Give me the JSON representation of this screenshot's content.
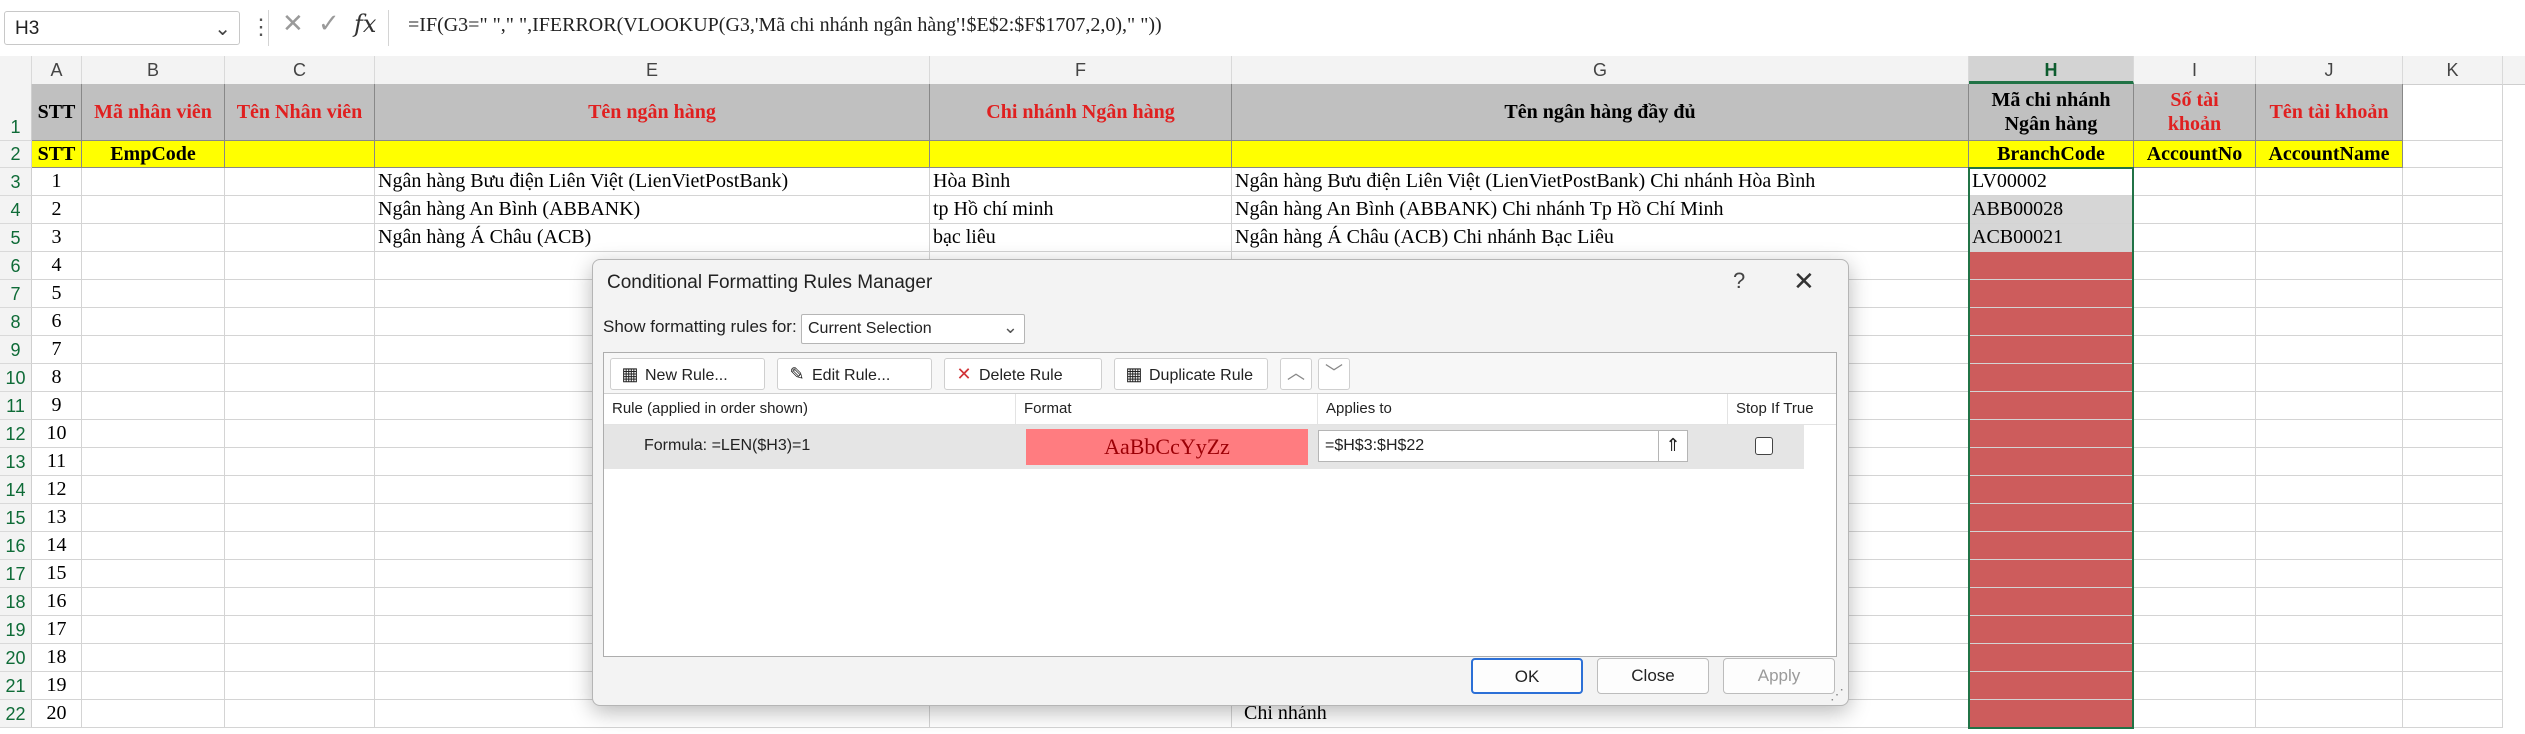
{
  "formula_bar": {
    "name_box": "H3",
    "formula": "=IF(G3=\" \",\" \",IFERROR(VLOOKUP(G3,'Mã chi nhánh ngân hàng'!$E$2:$F$1707,2,0),\" \"))"
  },
  "columns": [
    "A",
    "B",
    "C",
    "E",
    "F",
    "G",
    "H",
    "I",
    "J",
    "K"
  ],
  "header_row1": {
    "A": "STT",
    "B": "Mã nhân viên",
    "C": "Tên Nhân viên",
    "E": "Tên ngân hàng",
    "F": "Chi nhánh Ngân hàng",
    "G": "Tên ngân hàng đầy đủ",
    "H": "Mã chi nhánh Ngân hàng",
    "I": "Số tài khoản",
    "J": "Tên tài khoản"
  },
  "header_row2": {
    "A": "STT",
    "B": "EmpCode",
    "H": "BranchCode",
    "I": "AccountNo",
    "J": "AccountName"
  },
  "rows": [
    {
      "rn": "3",
      "stt": "1",
      "bank": "Ngân hàng Bưu điện Liên Việt (LienVietPostBank)",
      "branch": "Hòa Bình",
      "full": "Ngân hàng Bưu điện Liên Việt (LienVietPostBank) Chi nhánh Hòa Bình",
      "code": "LV00002"
    },
    {
      "rn": "4",
      "stt": "2",
      "bank": "Ngân hàng An Bình (ABBANK)",
      "branch": "tp Hồ chí minh",
      "full": "Ngân hàng An Bình (ABBANK) Chi nhánh Tp Hồ Chí Minh",
      "code": "ABB00028"
    },
    {
      "rn": "5",
      "stt": "3",
      "bank": "Ngân hàng Á Châu (ACB)",
      "branch": "bạc liêu",
      "full": "Ngân hàng Á Châu (ACB) Chi nhánh Bạc Liêu",
      "code": "ACB00021"
    },
    {
      "rn": "6",
      "stt": "4",
      "bank": "",
      "branch": "",
      "full": "",
      "code": ""
    },
    {
      "rn": "7",
      "stt": "5",
      "bank": "",
      "branch": "",
      "full": "",
      "code": ""
    },
    {
      "rn": "8",
      "stt": "6",
      "bank": "",
      "branch": "",
      "full": "",
      "code": ""
    },
    {
      "rn": "9",
      "stt": "7",
      "bank": "",
      "branch": "",
      "full": "",
      "code": ""
    },
    {
      "rn": "10",
      "stt": "8",
      "bank": "",
      "branch": "",
      "full": "",
      "code": ""
    },
    {
      "rn": "11",
      "stt": "9",
      "bank": "",
      "branch": "",
      "full": "",
      "code": ""
    },
    {
      "rn": "12",
      "stt": "10",
      "bank": "",
      "branch": "",
      "full": "",
      "code": ""
    },
    {
      "rn": "13",
      "stt": "11",
      "bank": "",
      "branch": "",
      "full": "",
      "code": ""
    },
    {
      "rn": "14",
      "stt": "12",
      "bank": "",
      "branch": "",
      "full": "",
      "code": ""
    },
    {
      "rn": "15",
      "stt": "13",
      "bank": "",
      "branch": "",
      "full": "",
      "code": ""
    },
    {
      "rn": "16",
      "stt": "14",
      "bank": "",
      "branch": "",
      "full": "",
      "code": ""
    },
    {
      "rn": "17",
      "stt": "15",
      "bank": "",
      "branch": "",
      "full": "",
      "code": ""
    },
    {
      "rn": "18",
      "stt": "16",
      "bank": "",
      "branch": "",
      "full": "",
      "code": ""
    },
    {
      "rn": "19",
      "stt": "17",
      "bank": "",
      "branch": "",
      "full": "",
      "code": ""
    },
    {
      "rn": "20",
      "stt": "18",
      "bank": "",
      "branch": "",
      "full": "",
      "code": ""
    },
    {
      "rn": "21",
      "stt": "19",
      "bank": "",
      "branch": "",
      "full": "",
      "code": ""
    },
    {
      "rn": "22",
      "stt": "20",
      "bank": "",
      "branch": "",
      "full": "Chi nhánh",
      "code": ""
    }
  ],
  "dialog": {
    "title": "Conditional Formatting Rules Manager",
    "help": "?",
    "show_label": "Show formatting rules for:",
    "show_value": "Current Selection",
    "buttons": {
      "new": "New Rule...",
      "edit": "Edit Rule...",
      "delete": "Delete Rule",
      "duplicate": "Duplicate Rule"
    },
    "list_headers": {
      "rule": "Rule (applied in order shown)",
      "format": "Format",
      "applies": "Applies to",
      "stop": "Stop If True"
    },
    "rule": {
      "text": "Formula: =LEN($H3)=1",
      "preview": "AaBbCcYyZz",
      "applies_to": "=$H$3:$H$22"
    },
    "footer": {
      "ok": "OK",
      "close": "Close",
      "apply": "Apply"
    }
  },
  "colors": {
    "header_grey": "#c0c0c0",
    "header_yellow": "#ffff00",
    "header_red_text": "#e02020",
    "rule_fill": "#cd5c5c",
    "format_preview": "#ff7c80",
    "excel_green": "#217346"
  }
}
